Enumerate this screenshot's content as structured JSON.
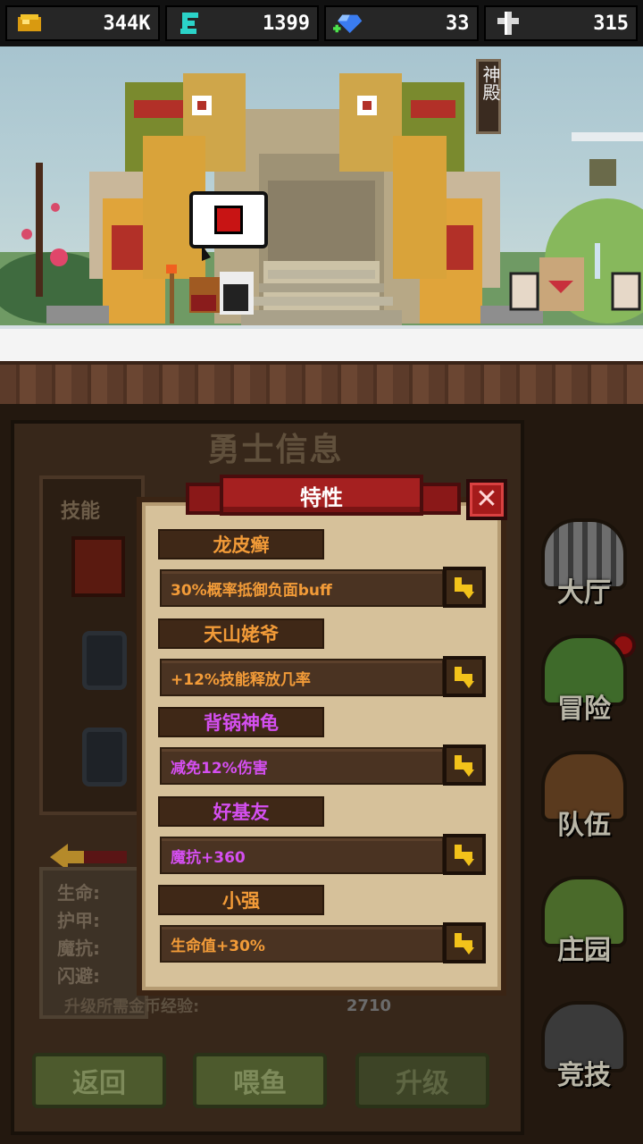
{
  "resources": {
    "gold": "344K",
    "energy": "1399",
    "gems": "33",
    "crosses": "315"
  },
  "scene": {
    "temple_sign": "神殿"
  },
  "panel": {
    "title": "勇士信息",
    "skill_label": "技能",
    "stats": [
      "生命:",
      "护甲:",
      "魔抗:",
      "闪避:"
    ],
    "exp_label": "升级所需金币经验:",
    "exp_value": "2710",
    "buttons": {
      "back": "返回",
      "feed": "喂鱼",
      "upgrade": "升级"
    }
  },
  "nav": {
    "hall": "大厅",
    "adventure": "冒险",
    "team": "队伍",
    "manor": "庄园",
    "arena": "竞技"
  },
  "dialog": {
    "title": "特性",
    "close": "✕",
    "traits": [
      {
        "name": "龙皮癣",
        "desc": "30%概率抵御负面buff",
        "rarity": "orange"
      },
      {
        "name": "天山姥爷",
        "desc": "+12%技能释放几率",
        "rarity": "orange"
      },
      {
        "name": "背锅神龟",
        "desc": "减免12%伤害",
        "rarity": "purple"
      },
      {
        "name": "好基友",
        "desc": "魔抗+360",
        "rarity": "purple"
      },
      {
        "name": "小强",
        "desc": "生命值+30%",
        "rarity": "orange"
      }
    ]
  },
  "colors": {
    "orange_trait": "#f29b38",
    "purple_trait": "#d44ff0",
    "banner_red": "#a52020"
  }
}
